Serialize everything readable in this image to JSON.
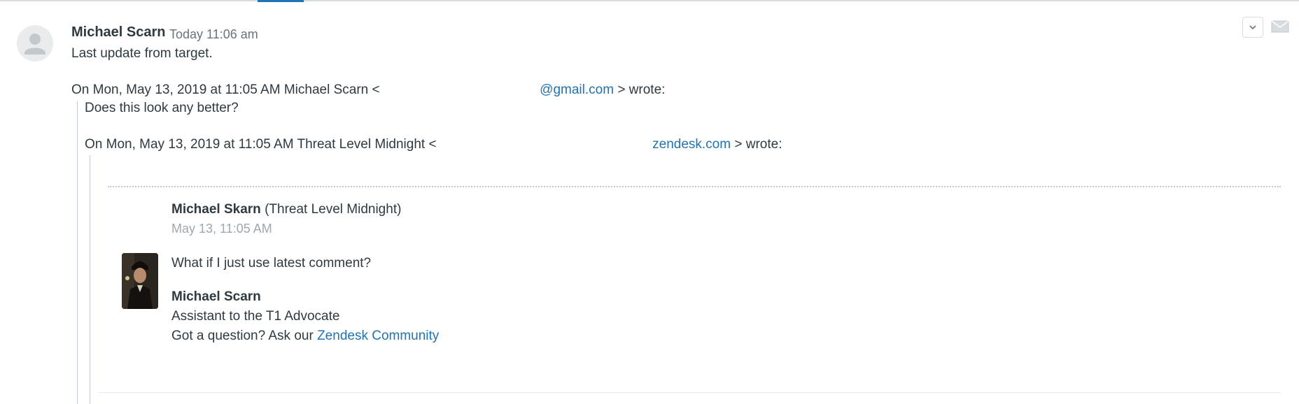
{
  "message": {
    "author": "Michael Scarn",
    "timestamp": "Today 11:06 am",
    "body": "Last update from target."
  },
  "quote1": {
    "header_prefix": "On Mon, May 13, 2019 at 11:05 AM Michael Scarn <",
    "header_link": "@gmail.com",
    "header_suffix": "> wrote:",
    "body": "Does this look any better?"
  },
  "quote2": {
    "header_prefix": "On Mon, May 13, 2019 at 11:05 AM Threat Level Midnight <",
    "header_link": "zendesk.com",
    "header_suffix": "> wrote:"
  },
  "comment": {
    "commenter_name": "Michael Skarn",
    "commenter_org": "(Threat Level Midnight)",
    "date": "May 13, 11:05 AM",
    "text": "What if I just use latest comment?",
    "signature_name": "Michael Scarn",
    "signature_title": "Assistant to the T1 Advocate",
    "signature_prompt": "Got a question? Ask our ",
    "signature_link": "Zendesk Community"
  },
  "icons": {
    "avatar": "user-silhouette-icon",
    "options": "chevron-down-icon",
    "channel": "mail-icon"
  },
  "colors": {
    "link": "#1f73b7",
    "text": "#2f3941",
    "muted": "#68737d"
  }
}
